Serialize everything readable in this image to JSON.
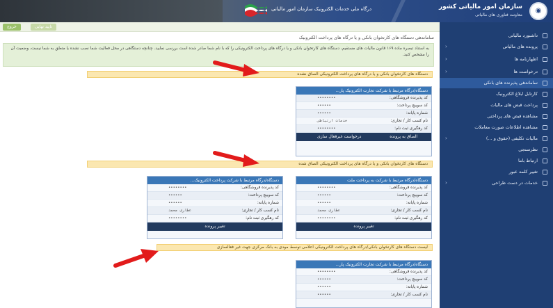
{
  "header": {
    "portal_title": "درگاه ملی خدمات الکترونیک سازمان امور مالیاتی",
    "org_name": "سازمان امور مالیاتی کشور",
    "org_sub": "معاونت فناوری های مالیاتی",
    "logo_glyph": "◉"
  },
  "top_strip": {
    "exit_label": "خروج",
    "confirm_label": "تایید نهایی"
  },
  "breadcrumb": "ساماندهی دستگاه های کارتخوان بانکی و یا درگاه های پرداخت الکترونیک",
  "notice": "به استناد تبصره ماده ۱۶۹ قانون مالیات های مستقیم، دستگاه های کارتخوان بانکی و یا درگاه های پرداخت الکترونیکی را که با نام شما صادر شده است بررسی نمایید. چنانچه دستگاهی در محل فعالیت شما نصب نشده یا متعلق به شما نیست، وضعیت آن را مشخص کنید.",
  "sections": {
    "unlinked_warning": "دستگاه های کارتخوان بانکی و یا درگاه های پرداخت الکترونیکی الصاق نشده",
    "linked_warning": "دستگاه های کارتخوان بانکی و یا درگاه های پرداخت الکترونیکی الصاق شده",
    "inactive_warning": "لیست دستگاه های کارتخوان بانکی/درگاه های پرداخت الکترونیکی اعلامی توسط مودی به بانک مرکزی جهت غیر فعالسازی"
  },
  "cards": {
    "unlinked": {
      "title": "دستگاه/درگاه مرتبط با شرکت تجارت الکترونیک پار...",
      "rows": [
        {
          "label": "کد پذیرنده فروشگاهی:",
          "value": "••••••••"
        },
        {
          "label": "کد سوییچ پرداخت:",
          "value": "••••••"
        },
        {
          "label": "شماره پایانه:",
          "value": "••••••"
        },
        {
          "label": "نام کسب کار / تجاری:",
          "value": "خدمات ارتباطی"
        },
        {
          "label": "کد رهگیری ثبت نام:",
          "value": "••••••••"
        }
      ],
      "foot_a": "الصاق به پرونده",
      "foot_b": "درخواست غیرفعال سازی"
    },
    "linked_right": {
      "title": "دستگاه/درگاه مرتبط با شرکت به پرداخت ملت",
      "rows": [
        {
          "label": "کد پذیرنده فروشگاهی:",
          "value": "••••••••"
        },
        {
          "label": "کد سوییچ پرداخت:",
          "value": "••••••"
        },
        {
          "label": "شماره پایانه:",
          "value": "••••••"
        },
        {
          "label": "نام کسب کار / تجاری:",
          "value": "عطاری محمد"
        },
        {
          "label": "کد رهگیری ثبت نام:",
          "value": "••••••••"
        }
      ],
      "foot_a": "تغییر پرونده"
    },
    "linked_left": {
      "title": "دستگاه/درگاه مرتبط با شرکت پرداخت الکترونیک...",
      "rows": [
        {
          "label": "کد پذیرنده فروشگاهی:",
          "value": "••••••••"
        },
        {
          "label": "کد سوییچ پرداخت:",
          "value": "••••••"
        },
        {
          "label": "شماره پایانه:",
          "value": "••••••"
        },
        {
          "label": "نام کسب کار / تجاری:",
          "value": "عطاری محمد"
        },
        {
          "label": "کد رهگیری ثبت نام:",
          "value": "••••••••"
        }
      ],
      "foot_a": "تغییر پرونده"
    },
    "inactive": {
      "title": "دستگاه/درگاه مرتبط با شرکت تجارت الکترونیک پار...",
      "rows": [
        {
          "label": "کد پذیرنده فروشگاهی:",
          "value": "••••••••"
        },
        {
          "label": "کد سوییچ پرداخت:",
          "value": "••••••"
        },
        {
          "label": "شماره پایانه:",
          "value": "••••••"
        },
        {
          "label": "نام کسب کار / تجاری:",
          "value": "••••••"
        }
      ]
    }
  },
  "sidebar": {
    "items": [
      {
        "label": "داشبورد مالیاتی"
      },
      {
        "label": "پرونده های مالیاتی"
      },
      {
        "label": "اظهارنامه ها"
      },
      {
        "label": "درخواست ها"
      },
      {
        "label": "ساماندهی پذیرنده های بانکی"
      },
      {
        "label": "کارتابل ابلاغ الکترونیک"
      },
      {
        "label": "پرداخت قبض های مالیات"
      },
      {
        "label": "مشاهده قبض های پرداختی"
      },
      {
        "label": "مشاهده اطلاعات صورت معاملات"
      },
      {
        "label": "مالیات تکلیفی (حقوق و ...)"
      },
      {
        "label": "نظرسنجی"
      },
      {
        "label": "ارتباط باما"
      },
      {
        "label": "تغییر کلمه عبور"
      },
      {
        "label": "خدمات در دست طراحی"
      }
    ]
  },
  "colors": {
    "accent": "#1f3f73",
    "card_head": "#3a77b7",
    "warning": "#fbe7b0",
    "arrow": "#e21b1b"
  }
}
